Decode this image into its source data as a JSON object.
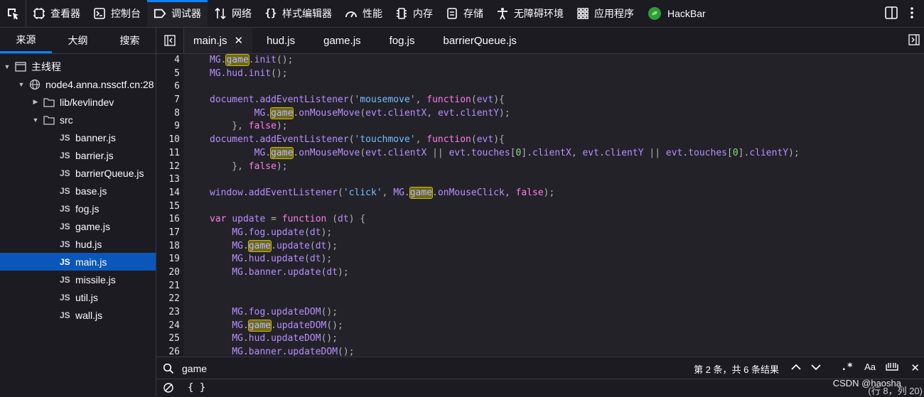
{
  "toolbar": {
    "tabs": [
      {
        "label": "查看器",
        "icon": "inspector-icon"
      },
      {
        "label": "控制台",
        "icon": "console-icon"
      },
      {
        "label": "调试器",
        "icon": "debugger-icon"
      },
      {
        "label": "网络",
        "icon": "network-icon"
      },
      {
        "label": "样式编辑器",
        "icon": "style-editor-icon"
      },
      {
        "label": "性能",
        "icon": "performance-icon"
      },
      {
        "label": "内存",
        "icon": "memory-icon"
      },
      {
        "label": "存储",
        "icon": "storage-icon"
      },
      {
        "label": "无障碍环境",
        "icon": "accessibility-icon"
      },
      {
        "label": "应用程序",
        "icon": "application-icon"
      },
      {
        "label": "HackBar",
        "icon": "hackbar-icon"
      }
    ],
    "active_tab": "调试器"
  },
  "left_panel": {
    "tabs": [
      "来源",
      "大纲",
      "搜索"
    ],
    "active_tab": "来源",
    "tree": {
      "main_thread": "主线程",
      "host": "node4.anna.nssctf.cn:28",
      "folder_lib": "lib/kevlindev",
      "folder_src": "src",
      "files": [
        "banner.js",
        "barrier.js",
        "barrierQueue.js",
        "base.js",
        "fog.js",
        "game.js",
        "hud.js",
        "main.js",
        "missile.js",
        "util.js",
        "wall.js"
      ],
      "selected_file": "main.js",
      "js_badge": "JS"
    }
  },
  "editor": {
    "tabs": [
      "main.js",
      "hud.js",
      "game.js",
      "fog.js",
      "barrierQueue.js"
    ],
    "active_tab": "main.js",
    "close_glyph": "✕",
    "lines": [
      {
        "n": "4",
        "text": "MG.game.init();"
      },
      {
        "n": "5",
        "text": "MG.hud.init();"
      },
      {
        "n": "6",
        "text": ""
      },
      {
        "n": "7",
        "text": "document.addEventListener('mousemove', function(evt){"
      },
      {
        "n": "8",
        "text": "        MG.game.onMouseMove(evt.clientX, evt.clientY);"
      },
      {
        "n": "9",
        "text": "    }, false);"
      },
      {
        "n": "10",
        "text": "document.addEventListener('touchmove', function(evt){"
      },
      {
        "n": "11",
        "text": "        MG.game.onMouseMove(evt.clientX || evt.touches[0].clientX, evt.clientY || evt.touches[0].clientY);"
      },
      {
        "n": "12",
        "text": "    }, false);"
      },
      {
        "n": "13",
        "text": ""
      },
      {
        "n": "14",
        "text": "window.addEventListener('click', MG.game.onMouseClick, false);"
      },
      {
        "n": "15",
        "text": ""
      },
      {
        "n": "16",
        "text": "var update = function (dt) {"
      },
      {
        "n": "17",
        "text": "    MG.fog.update(dt);"
      },
      {
        "n": "18",
        "text": "    MG.game.update(dt);"
      },
      {
        "n": "19",
        "text": "    MG.hud.update(dt);"
      },
      {
        "n": "20",
        "text": "    MG.banner.update(dt);"
      },
      {
        "n": "21",
        "text": ""
      },
      {
        "n": "22",
        "text": ""
      },
      {
        "n": "23",
        "text": "    MG.fog.updateDOM();"
      },
      {
        "n": "24",
        "text": "    MG.game.updateDOM();"
      },
      {
        "n": "25",
        "text": "    MG.hud.updateDOM();"
      },
      {
        "n": "26",
        "text": "    MG.banner.updateDOM();"
      }
    ],
    "highlight_term": "game"
  },
  "search": {
    "value": "game",
    "result": "第 2 条，共 6 条结果",
    "regex_label": ".*",
    "case_label": "Aa",
    "close_glyph": "✕"
  },
  "footer": {
    "pretty_print": "{ }",
    "position": "(行 8，列 20)",
    "watermark": "CSDN @haosha"
  },
  "colors": {
    "accent": "#0a84ff",
    "selected": "#0b57b9",
    "match_highlight": "#6b6a1d"
  }
}
